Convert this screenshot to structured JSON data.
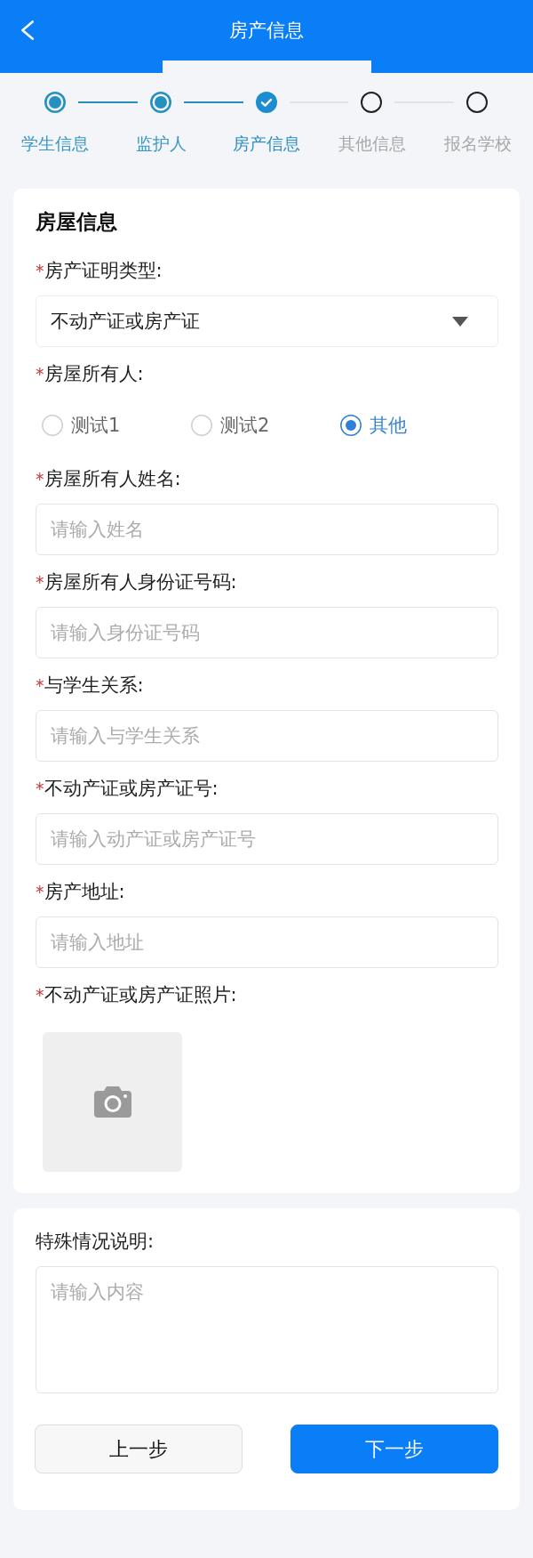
{
  "header": {
    "title": "房产信息"
  },
  "steps": [
    {
      "label": "学生信息",
      "completed": true,
      "selected": false
    },
    {
      "label": "监护人",
      "completed": true,
      "selected": false
    },
    {
      "label": "房产信息",
      "completed": true,
      "selected": true
    },
    {
      "label": "其他信息",
      "completed": false,
      "selected": false
    },
    {
      "label": "报名学校",
      "completed": false,
      "selected": false
    }
  ],
  "house_info": {
    "title": "房屋信息",
    "fields": [
      {
        "kind": "select",
        "required_mark": "*",
        "label": "房产证明类型:",
        "value": "不动产证或房产证"
      },
      {
        "kind": "radio",
        "required_mark": "*",
        "label": "房屋所有人:",
        "options": [
          {
            "label": "测试1",
            "selected": false
          },
          {
            "label": "测试2",
            "selected": false
          },
          {
            "label": "其他",
            "selected": true
          }
        ]
      },
      {
        "kind": "input",
        "required_mark": "*",
        "label": "房屋所有人姓名:",
        "placeholder": "请输入姓名"
      },
      {
        "kind": "input",
        "required_mark": "*",
        "label": "房屋所有人身份证号码:",
        "placeholder": "请输入身份证号码"
      },
      {
        "kind": "input",
        "required_mark": "*",
        "label": "与学生关系:",
        "placeholder": "请输入与学生关系"
      },
      {
        "kind": "input",
        "required_mark": "*",
        "label": "不动产证或房产证号:",
        "placeholder": "请输入动产证或房产证号"
      },
      {
        "kind": "input",
        "required_mark": "*",
        "label": "房产地址:",
        "placeholder": "请输入地址"
      },
      {
        "kind": "upload",
        "required_mark": "*",
        "label": "不动产证或房产证照片:"
      }
    ]
  },
  "remarks": {
    "label": "特殊情况说明:",
    "placeholder": "请输入内容"
  },
  "buttons": [
    {
      "label": "上一步",
      "kind": "secondary"
    },
    {
      "label": "下一步",
      "kind": "primary"
    }
  ]
}
